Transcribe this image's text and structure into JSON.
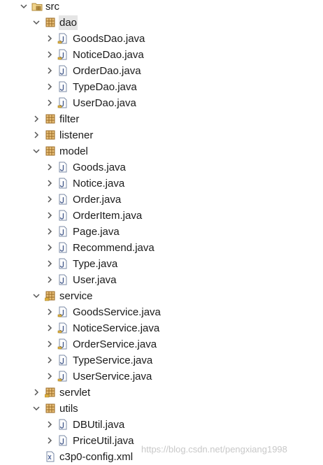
{
  "tree": {
    "src": "src",
    "dao": {
      "label": "dao",
      "files": [
        "GoodsDao.java",
        "NoticeDao.java",
        "OrderDao.java",
        "TypeDao.java",
        "UserDao.java"
      ]
    },
    "filter": "filter",
    "listener": "listener",
    "model": {
      "label": "model",
      "files": [
        "Goods.java",
        "Notice.java",
        "Order.java",
        "OrderItem.java",
        "Page.java",
        "Recommend.java",
        "Type.java",
        "User.java"
      ]
    },
    "service": {
      "label": "service",
      "files": [
        "GoodsService.java",
        "NoticeService.java",
        "OrderService.java",
        "TypeService.java",
        "UserService.java"
      ]
    },
    "servlet": "servlet",
    "utils": {
      "label": "utils",
      "files": [
        "DBUtil.java",
        "PriceUtil.java"
      ]
    },
    "config_file": "c3p0-config.xml"
  },
  "watermark": "https://blog.csdn.net/pengxiang1998",
  "colors": {
    "selection": "#e5e5e5",
    "package_icon": "#b07a2e",
    "java_icon_border": "#7a8aa6",
    "java_letter": "#4a5f8f",
    "twisty": "#555555",
    "watermark": "#c8c8c8"
  }
}
